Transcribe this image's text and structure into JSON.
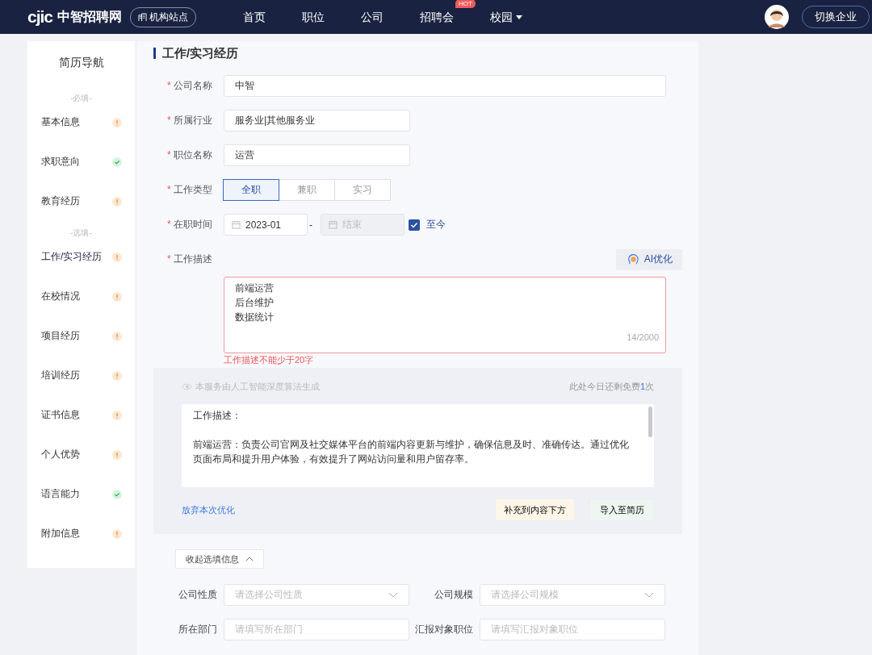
{
  "header": {
    "logo_mark": "cjic",
    "logo_text": "中智招聘网",
    "site_badge": "机构站点",
    "nav": [
      {
        "label": "首页",
        "dropdown": false
      },
      {
        "label": "职位",
        "dropdown": false
      },
      {
        "label": "公司",
        "dropdown": false
      },
      {
        "label": "招聘会",
        "badge": "HOT",
        "dropdown": false
      },
      {
        "label": "校园",
        "dropdown": true
      }
    ],
    "switch_button": "切换企业"
  },
  "sidebar": {
    "title": "简历导航",
    "groups": [
      {
        "heading": "-必填-",
        "items": [
          {
            "label": "基本信息",
            "complete": false,
            "selected": false
          },
          {
            "label": "求职意向",
            "complete": true,
            "selected": false
          },
          {
            "label": "教育经历",
            "complete": false,
            "selected": false
          }
        ]
      },
      {
        "heading": "-选填-",
        "items": [
          {
            "label": "工作/实习经历",
            "complete": false,
            "selected": true
          },
          {
            "label": "在校情况",
            "complete": false,
            "selected": false
          },
          {
            "label": "项目经历",
            "complete": false,
            "selected": false
          },
          {
            "label": "培训经历",
            "complete": false,
            "selected": false
          },
          {
            "label": "证书信息",
            "complete": false,
            "selected": false
          },
          {
            "label": "个人优势",
            "complete": false,
            "selected": false
          },
          {
            "label": "语言能力",
            "complete": true,
            "selected": false
          },
          {
            "label": "附加信息",
            "complete": false,
            "selected": false
          }
        ]
      }
    ]
  },
  "section_title": "工作/实习经历",
  "form": [
    {
      "kind": "text",
      "required_mark": "*",
      "label": "公司名称",
      "value": "中智",
      "wide": true
    },
    {
      "kind": "text",
      "required_mark": "*",
      "label": "所属行业",
      "value": "服务业|其他服务业",
      "wide": false
    },
    {
      "kind": "text",
      "required_mark": "*",
      "label": "职位名称",
      "value": "运营",
      "wide": false
    },
    {
      "kind": "segmented",
      "required_mark": "*",
      "label": "工作类型",
      "options": [
        {
          "label": "全职",
          "selected": true
        },
        {
          "label": "兼职",
          "selected": false
        },
        {
          "label": "实习",
          "selected": false
        }
      ]
    },
    {
      "kind": "daterange",
      "required_mark": "*",
      "label": "在职时间",
      "start": "2023-01",
      "separator": "-",
      "end_placeholder": "结束",
      "end_disabled": true,
      "until_now": {
        "label": "至今",
        "checked": true
      }
    }
  ],
  "description": {
    "required_mark": "*",
    "label": "工作描述",
    "ai_button": "AI优化",
    "lines": [
      "前端运营",
      "后台维护",
      "数据统计"
    ],
    "counter": "14/2000",
    "error": "工作描述不能少于20字"
  },
  "ai_panel": {
    "note": "本服务由人工智能深度算法生成",
    "quota": "此处今日还剩免费**1**次",
    "paragraphs": [
      "工作描述：",
      "前端运营：负责公司官网及社交媒体平台的前端内容更新与维护，确保信息及时、准确传达。通过优化页面布局和提升用户体验，有效提升了网站访问量和用户留存率。"
    ],
    "discard": "放弃本次优化",
    "append_button": "补充到内容下方",
    "import_button": "导入至简历"
  },
  "collapse_button": "收起选填信息",
  "optional_fields": [
    {
      "kind": "select",
      "label": "公司性质",
      "placeholder": "请选择公司性质"
    },
    {
      "kind": "select",
      "label": "公司规模",
      "placeholder": "请选择公司规模"
    },
    {
      "kind": "input",
      "label": "所在部门",
      "placeholder": "请填写所在部门"
    },
    {
      "kind": "input",
      "label": "汇报对象职位",
      "placeholder": "请填写汇报对象职位"
    }
  ]
}
